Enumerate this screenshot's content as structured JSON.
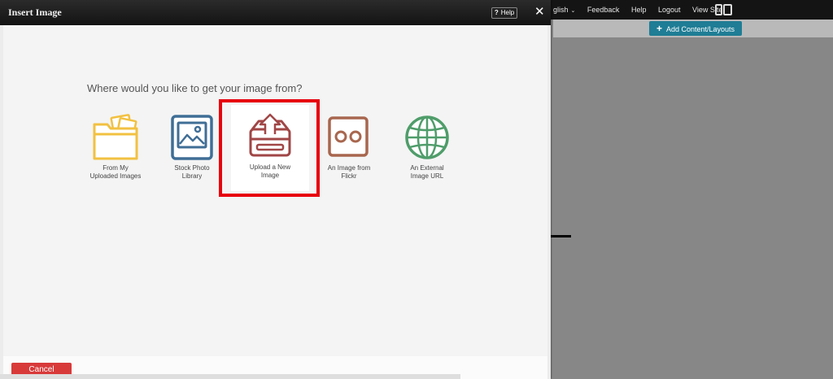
{
  "site": {
    "nav": [
      "glish",
      "Feedback",
      "Help",
      "Logout",
      "View Site"
    ],
    "add_content_label": "Add Content/Layouts"
  },
  "dialog": {
    "title": "Insert Image",
    "help_label": "Help",
    "close_glyph": "✕",
    "prompt": "Where would you like to get your image from?",
    "options": [
      {
        "label_line1": "From My",
        "label_line2": "Uploaded Images",
        "icon": "folder-images-icon"
      },
      {
        "label_line1": "Stock Photo",
        "label_line2": "Library",
        "icon": "picture-frame-icon"
      },
      {
        "label_line1": "Upload a New",
        "label_line2": "Image",
        "icon": "upload-tray-icon"
      },
      {
        "label_line1": "An Image from",
        "label_line2": "Flickr",
        "icon": "flickr-icon"
      },
      {
        "label_line1": "An External",
        "label_line2": "Image URL",
        "icon": "globe-icon"
      }
    ],
    "cancel_label": "Cancel"
  },
  "colors": {
    "folder": "#f2c141",
    "stock": "#3f6e96",
    "upload": "#a14646",
    "flickr": "#a8664e",
    "globe": "#4f9d6a",
    "highlight": "#e8000d",
    "cancel": "#d83a3a",
    "accent": "#1f7d95"
  }
}
